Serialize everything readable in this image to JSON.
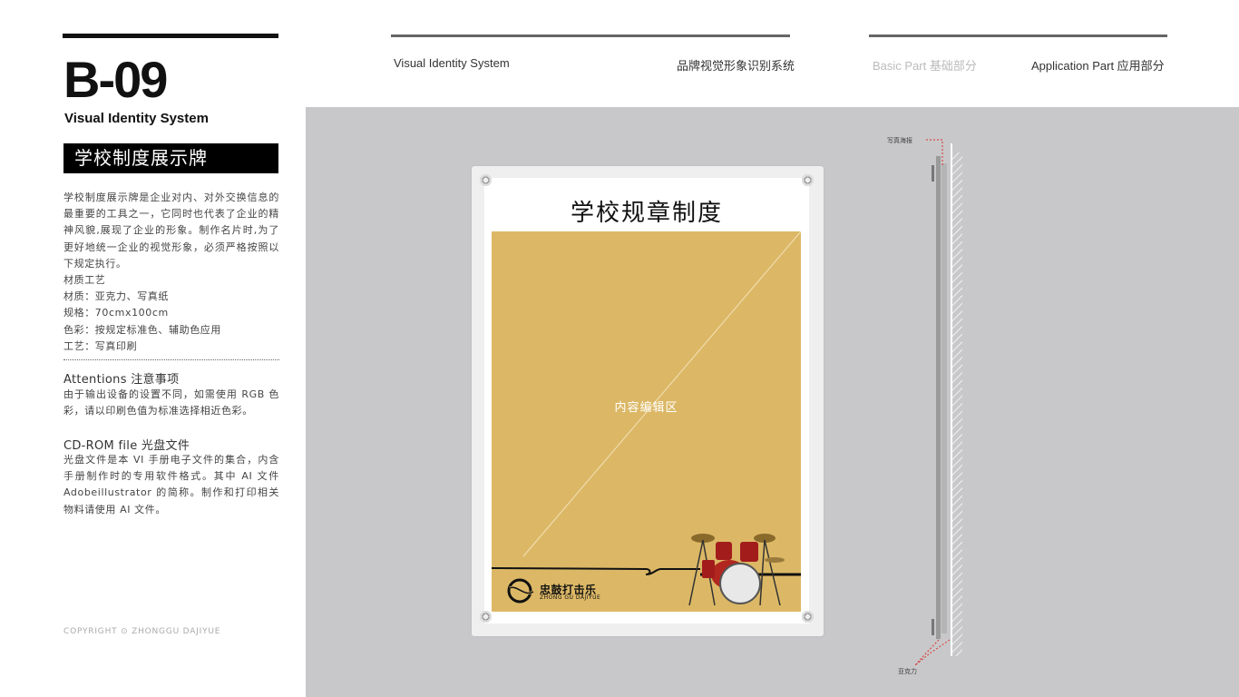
{
  "left": {
    "code": "B-09",
    "subtitle": "Visual Identity System",
    "title": "学校制度展示牌",
    "desc_lines": [
      "学校制度展示牌是企业对内、对外交换信息的最重要的工具之一，它同时也代表了企业的精神风貌,展现了企业的形象。制作名片时,为了更好地统一企业的视觉形象，必须严格按照以下规定执行。",
      "材质工艺",
      "材质：亚克力、写真纸",
      "规格：70cmx100cm",
      "色彩：按规定标准色、辅助色应用",
      "工艺：写真印刷"
    ],
    "attentions_title": "Attentions 注意事项",
    "attentions_body": "由于输出设备的设置不同，如需使用 RGB 色彩，请以印刷色值为标准选择相近色彩。",
    "cdrom_title": "CD-ROM file 光盘文件",
    "cdrom_body": "光盘文件是本 VI 手册电子文件的集合，内含手册制作时的专用软件格式。其中 AI 文件 Adobeillustrator 的简称。制作和打印相关物料请使用 AI 文件。",
    "copyright": "COPYRIGHT ⊙ ZHONGGU DAJIYUE"
  },
  "header": {
    "vis_en": "Visual Identity System",
    "vis_cn": "品牌视觉形象识别系统",
    "basic_part": "Basic Part 基础部分",
    "application_part": "Application Part 应用部分"
  },
  "poster": {
    "title": "学校规章制度",
    "content_label": "内容编辑区",
    "brand_cn": "忠鼓打击乐",
    "brand_en": "ZHONG GU DAJIYUE",
    "area_color": "#dcb866"
  },
  "side_view": {
    "top_label": "写真海报",
    "bottom_label": "亚克力"
  },
  "colors": {
    "stage": "#c8c8ca",
    "accent_red": "#d9302a"
  }
}
